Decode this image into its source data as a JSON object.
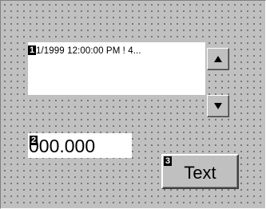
{
  "listbox": {
    "index_badge": "1",
    "item_text": "1/1999 12:00:00 PM ! 4..."
  },
  "spinner": {
    "up_icon": "triangle-up-icon",
    "down_icon": "triangle-down-icon"
  },
  "numeric_field": {
    "index_badge": "2",
    "value": "000.000"
  },
  "text_button": {
    "index_badge": "3",
    "label": "Text"
  }
}
